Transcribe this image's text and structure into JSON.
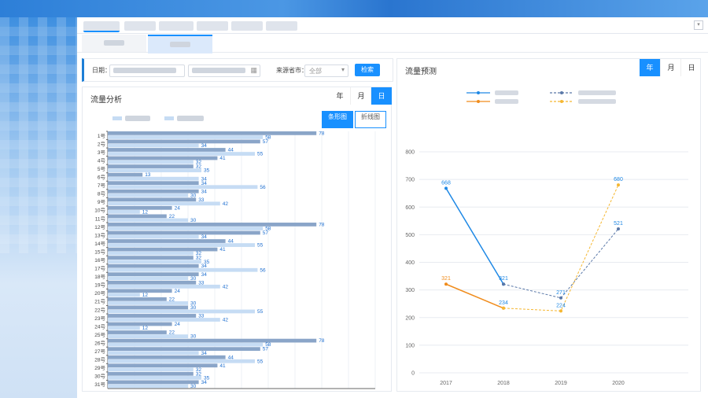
{
  "filter": {
    "date_label": "日期：",
    "region_label": "来源省市：",
    "region_value": "全部",
    "search_button": "检索"
  },
  "left_panel": {
    "title": "流量分析",
    "period_tabs": [
      "年",
      "月",
      "日"
    ],
    "active_period": "日",
    "view_toggle": [
      "条形图",
      "折线图"
    ],
    "active_view": "条形图"
  },
  "right_panel": {
    "title": "流量预测",
    "period_tabs": [
      "年",
      "月",
      "日"
    ],
    "active_period": "年"
  },
  "colors": {
    "accent": "#1890ff",
    "bar_dark": "#8aa5c8",
    "bar_light": "#c6dcf4",
    "line_blue": "#1e88e5",
    "line_orange": "#f08c1c",
    "line_blue_dash": "#5a78a8",
    "line_orange_dash": "#f5b731"
  },
  "chart_data": [
    {
      "type": "bar",
      "orientation": "horizontal",
      "categories": [
        "1号",
        "2号",
        "3号",
        "4号",
        "5号",
        "6号",
        "7号",
        "8号",
        "9号",
        "10号",
        "11号",
        "12号",
        "13号",
        "14号",
        "15号",
        "16号",
        "17号",
        "18号",
        "19号",
        "20号",
        "21号",
        "22号",
        "23号",
        "24号",
        "25号",
        "26号",
        "27号",
        "28号",
        "29号",
        "30号",
        "31号"
      ],
      "series": [
        {
          "color": "#8aa5c8",
          "values": [
            78,
            57,
            44,
            41,
            32,
            13,
            34,
            34,
            33,
            24,
            22,
            78,
            57,
            44,
            41,
            32,
            34,
            34,
            33,
            24,
            22,
            30,
            33,
            24,
            22,
            78,
            57,
            44,
            41,
            32,
            34
          ]
        },
        {
          "color": "#c6dcf4",
          "values": [
            58,
            34,
            55,
            32,
            35,
            34,
            56,
            30,
            42,
            12,
            30,
            58,
            34,
            55,
            32,
            35,
            56,
            30,
            42,
            12,
            30,
            55,
            42,
            12,
            30,
            58,
            34,
            55,
            32,
            35,
            30
          ]
        }
      ],
      "xlim": [
        0,
        100
      ],
      "xticks": [
        0,
        10,
        20,
        30,
        40,
        50,
        60,
        70,
        80,
        90,
        100
      ],
      "grid": true
    },
    {
      "type": "line",
      "x": [
        "2017",
        "2018",
        "2019",
        "2020"
      ],
      "ylim": [
        0,
        800
      ],
      "yticks": [
        0,
        100,
        200,
        300,
        400,
        500,
        600,
        700,
        800
      ],
      "series": [
        {
          "color": "#1e88e5",
          "style": "solid",
          "points": [
            {
              "x": "2017",
              "y": 668
            },
            {
              "x": "2018",
              "y": 321
            }
          ]
        },
        {
          "color": "#5a78a8",
          "style": "dashed",
          "points": [
            {
              "x": "2018",
              "y": 321
            },
            {
              "x": "2019",
              "y": 271
            },
            {
              "x": "2020",
              "y": 521
            }
          ]
        },
        {
          "color": "#f08c1c",
          "style": "solid",
          "points": [
            {
              "x": "2017",
              "y": 321
            },
            {
              "x": "2018",
              "y": 234
            }
          ]
        },
        {
          "color": "#f5b731",
          "style": "dashed",
          "points": [
            {
              "x": "2018",
              "y": 234
            },
            {
              "x": "2019",
              "y": 224
            },
            {
              "x": "2020",
              "y": 680
            }
          ]
        }
      ],
      "data_labels": [
        {
          "x": "2017",
          "y": 668,
          "text": "668",
          "color": "#1e88e5"
        },
        {
          "x": "2018",
          "y": 321,
          "text": "321",
          "color": "#1e88e5"
        },
        {
          "x": "2019",
          "y": 271,
          "text": "271",
          "color": "#1e88e5"
        },
        {
          "x": "2020",
          "y": 521,
          "text": "521",
          "color": "#1e88e5"
        },
        {
          "x": "2017",
          "y": 321,
          "text": "321",
          "color": "#f08c1c"
        },
        {
          "x": "2018",
          "y": 234,
          "text": "234",
          "color": "#1e88e5"
        },
        {
          "x": "2019",
          "y": 224,
          "text": "224",
          "color": "#1e88e5"
        },
        {
          "x": "2020",
          "y": 680,
          "text": "680",
          "color": "#1e88e5"
        }
      ],
      "grid": true,
      "legend": "top-center"
    }
  ]
}
